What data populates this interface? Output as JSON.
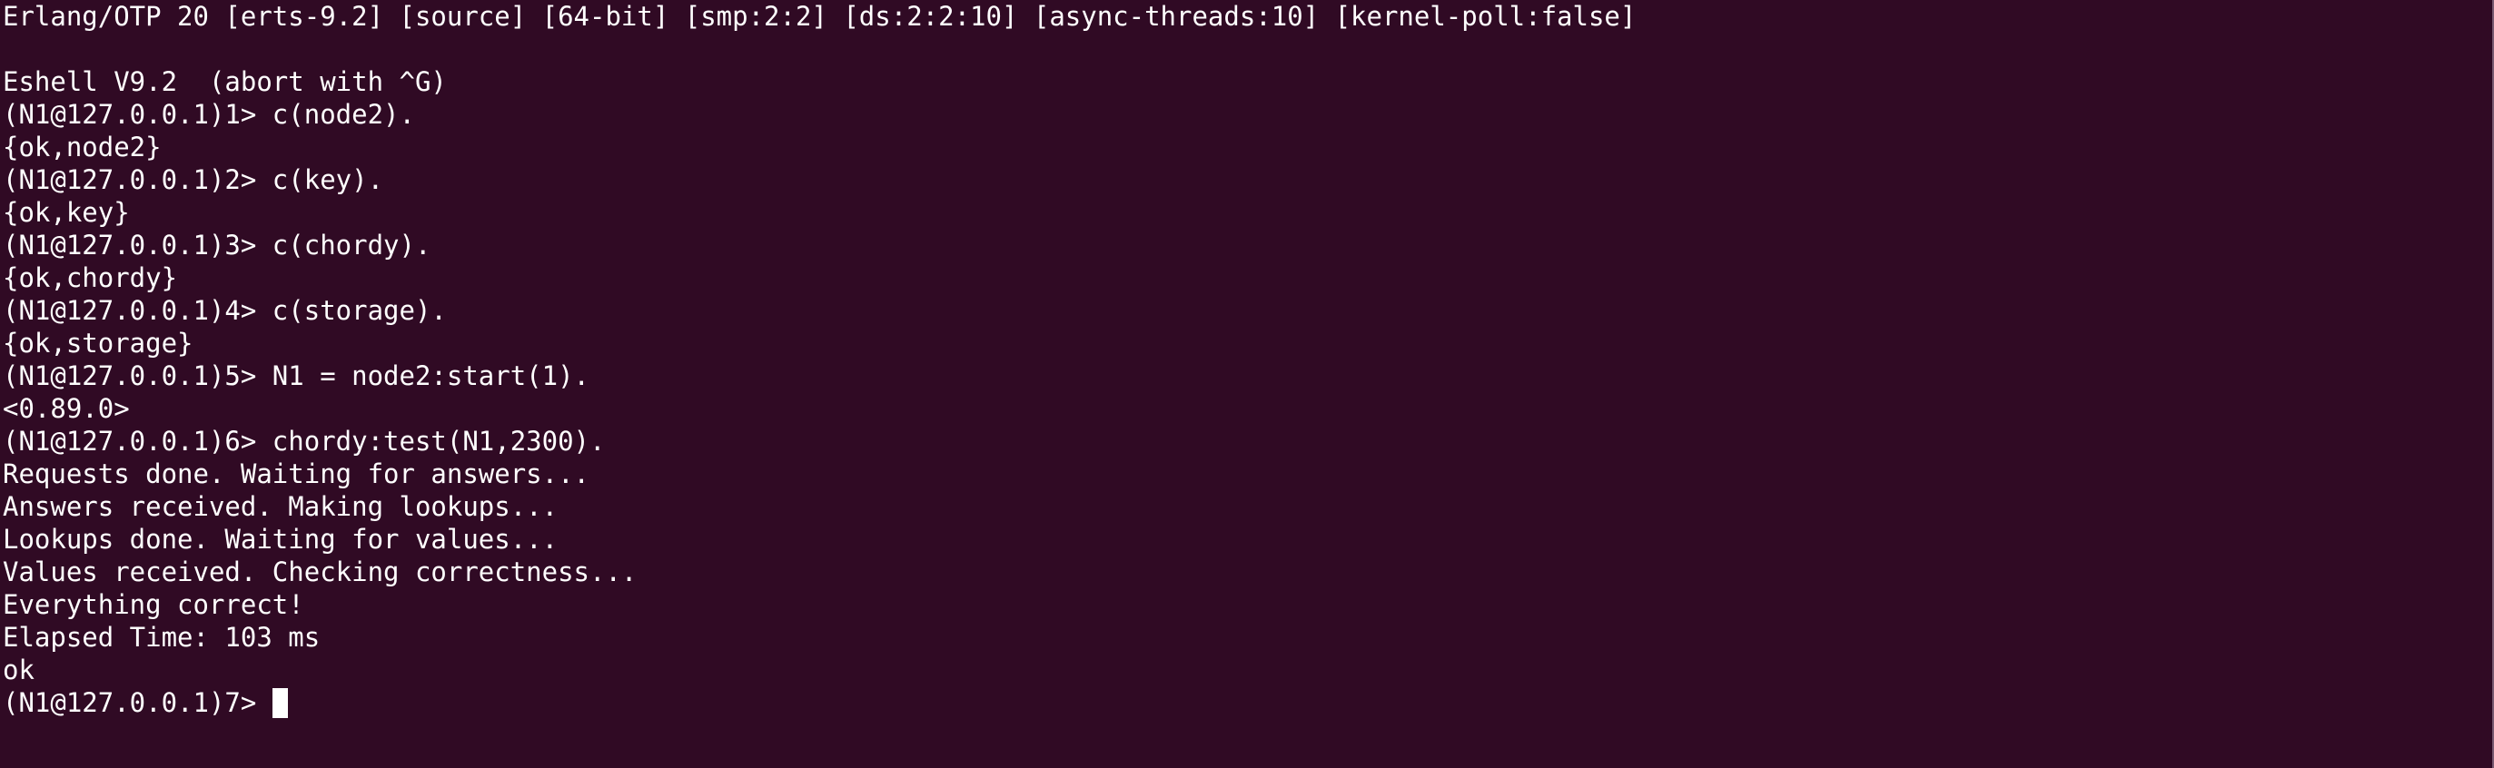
{
  "terminal": {
    "lines": [
      "Erlang/OTP 20 [erts-9.2] [source] [64-bit] [smp:2:2] [ds:2:2:10] [async-threads:10] [kernel-poll:false]",
      "",
      "Eshell V9.2  (abort with ^G)",
      "(N1@127.0.0.1)1> c(node2).",
      "{ok,node2}",
      "(N1@127.0.0.1)2> c(key).",
      "{ok,key}",
      "(N1@127.0.0.1)3> c(chordy).",
      "{ok,chordy}",
      "(N1@127.0.0.1)4> c(storage).",
      "{ok,storage}",
      "(N1@127.0.0.1)5> N1 = node2:start(1).",
      "<0.89.0>",
      "(N1@127.0.0.1)6> chordy:test(N1,2300).",
      "Requests done. Waiting for answers...",
      "Answers received. Making lookups...",
      "Lookups done. Waiting for values...",
      "Values received. Checking correctness...",
      "Everything correct!",
      "Elapsed Time: 103 ms",
      "ok"
    ],
    "prompt": "(N1@127.0.0.1)7> "
  },
  "colors": {
    "background": "#300a24",
    "text": "#ffffff"
  }
}
